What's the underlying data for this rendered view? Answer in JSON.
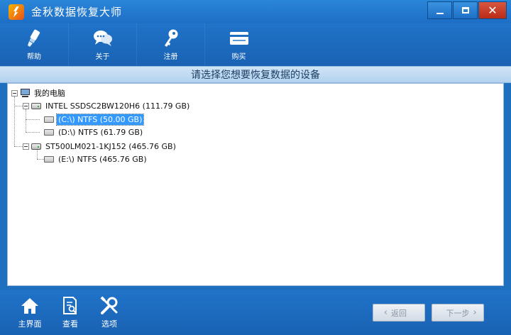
{
  "window": {
    "title": "金秋数据恢复大师",
    "controls": [
      "minimize-icon",
      "maximize-icon",
      "close-icon"
    ]
  },
  "toolbar": {
    "items": [
      {
        "label": "帮助",
        "icon": "help-brush-icon"
      },
      {
        "label": "关于",
        "icon": "about-chat-icon"
      },
      {
        "label": "注册",
        "icon": "register-key-icon"
      },
      {
        "label": "购买",
        "icon": "buy-card-icon"
      }
    ]
  },
  "header": {
    "text": "请选择您想要恢复数据的设备"
  },
  "tree": {
    "root": "我的电脑",
    "disks": [
      {
        "label": "INTEL SSDSC2BW120H6 (111.79 GB)",
        "partitions": [
          {
            "label": "(C:\\) NTFS (50.00 GB)",
            "selected": true
          },
          {
            "label": "(D:\\) NTFS (61.79 GB)",
            "selected": false
          }
        ]
      },
      {
        "label": "ST500LM021-1KJ152 (465.76 GB)",
        "partitions": [
          {
            "label": "(E:\\) NTFS (465.76 GB)",
            "selected": false
          }
        ]
      }
    ]
  },
  "bottom": {
    "items": [
      {
        "label": "主界面",
        "icon": "home-icon"
      },
      {
        "label": "查看",
        "icon": "view-document-icon"
      },
      {
        "label": "选项",
        "icon": "options-tools-icon"
      }
    ],
    "back_label": "返回",
    "next_label": "下一步"
  },
  "colors": {
    "primary_blue": "#1f6fc0",
    "selection_blue": "#3399ff",
    "close_red": "#c8412a"
  }
}
